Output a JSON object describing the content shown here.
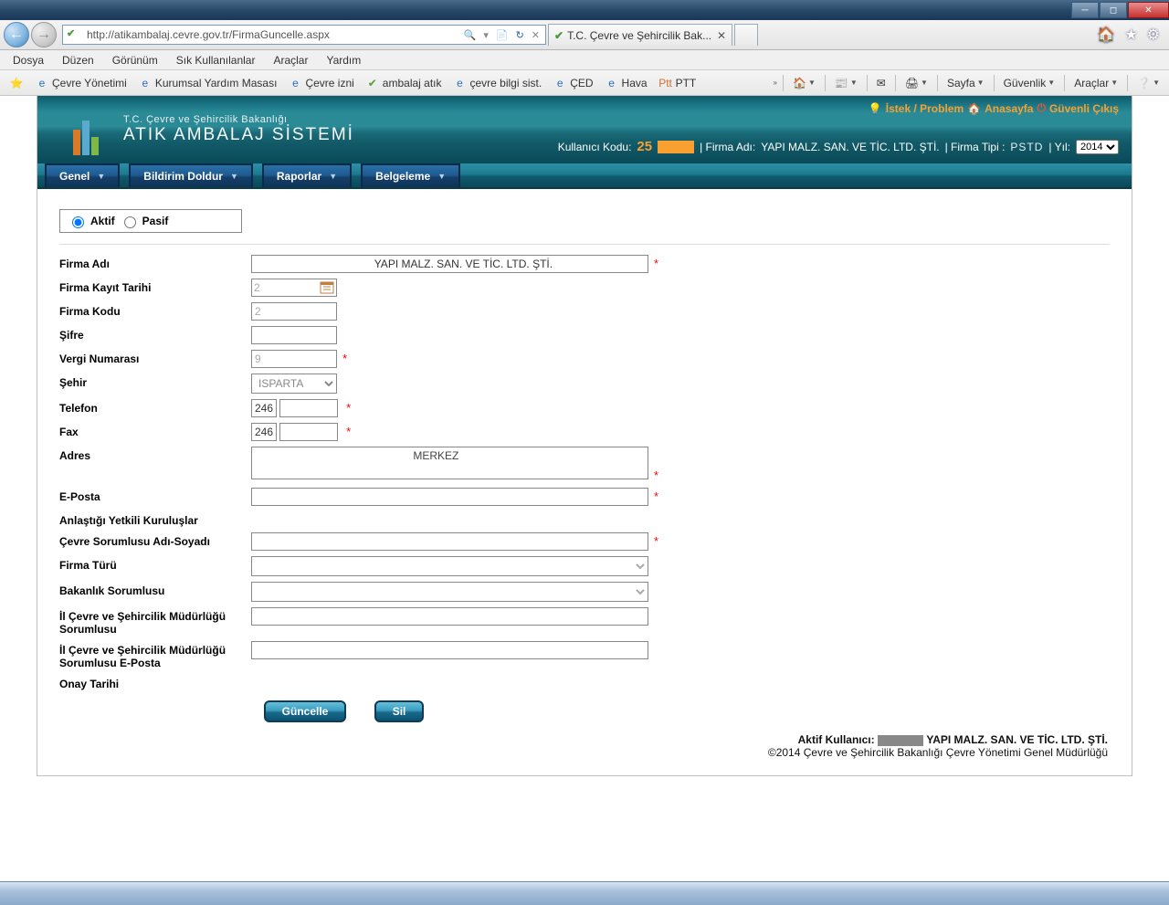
{
  "window": {
    "url": "http://atikambalaj.cevre.gov.tr/FirmaGuncelle.aspx",
    "tab_title": "T.C. Çevre ve Şehircilik Bak...",
    "search_symbols": "🔍",
    "refresh": "⟳",
    "stop": "✕"
  },
  "ie_menu": {
    "file": "Dosya",
    "edit": "Düzen",
    "view": "Görünüm",
    "favorites": "Sık Kullanılanlar",
    "tools": "Araçlar",
    "help": "Yardım"
  },
  "bookmarks": {
    "b1": "Çevre Yönetimi",
    "b2": "Kurumsal Yardım Masası",
    "b3": "Çevre izni",
    "b4": "ambalaj atık",
    "b5": "çevre bilgi sist.",
    "b6": "ÇED",
    "b7": "Hava",
    "b8": "PTT"
  },
  "ie_toolbar": {
    "page": "Sayfa",
    "safety": "Güvenlik",
    "tools": "Araçlar"
  },
  "header": {
    "ministry": "T.C. Çevre ve Şehircilik Bakanlığı",
    "title": "ATIK AMBALAJ SİSTEMİ",
    "link_problem": "İstek / Problem",
    "link_home": "Anasayfa",
    "link_logout": "Güvenli Çıkış",
    "user_code_label": "Kullanıcı Kodu:",
    "user_code_value": "25",
    "firm_label": "| Firma Adı:",
    "firm_value": "YAPI MALZ. SAN. VE TİC. LTD. ŞTİ.",
    "type_label": "| Firma Tipi :",
    "type_value": "PSTD",
    "year_label": "| Yıl:",
    "year_value": "2014"
  },
  "nav": {
    "m1": "Genel",
    "m2": "Bildirim Doldur",
    "m3": "Raporlar",
    "m4": "Belgeleme"
  },
  "form": {
    "radio_active": "Aktif",
    "radio_passive": "Pasif",
    "lbl_firma_adi": "Firma Adı",
    "val_firma_adi": "         YAPI MALZ. SAN. VE TİC. LTD. ŞTİ.",
    "lbl_kayit_tarihi": "Firma Kayıt Tarihi",
    "val_kayit_tarihi": "2",
    "lbl_firma_kodu": "Firma Kodu",
    "val_firma_kodu": "2",
    "lbl_sifre": "Şifre",
    "val_sifre": "",
    "lbl_vergi": "Vergi Numarası",
    "val_vergi": "9",
    "lbl_sehir": "Şehir",
    "val_sehir": "ISPARTA",
    "lbl_telefon": "Telefon",
    "val_tel1": "246",
    "val_tel2": "",
    "lbl_fax": "Fax",
    "val_fax1": "246",
    "val_fax2": "",
    "lbl_adres": "Adres",
    "val_adres": "                                                    MERKEZ",
    "lbl_eposta": "E-Posta",
    "val_eposta": "",
    "lbl_yetk_kurulus": "Anlaştığı Yetkili Kuruluşlar",
    "val_yetk_kurulus": "",
    "lbl_cevre_sor": "Çevre Sorumlusu Adı-Soyadı",
    "val_cevre_sor": "",
    "lbl_firma_turu": "Firma Türü",
    "val_firma_turu": "",
    "lbl_bakanlik": "Bakanlık Sorumlusu",
    "val_bakanlik": "",
    "lbl_il_sor": "İl Çevre ve Şehircilik Müdürlüğü Sorumlusu",
    "val_il_sor": "",
    "lbl_il_sor_eposta": "İl Çevre ve Şehircilik Müdürlüğü Sorumlusu E-Posta",
    "val_il_sor_eposta": "",
    "lbl_onay_tarihi": "Onay Tarihi",
    "btn_update": "Güncelle",
    "btn_delete": "Sil"
  },
  "footer": {
    "active_user_label": "Aktif Kullanıcı:",
    "active_user_value": "YAPI MALZ. SAN. VE TİC. LTD. ŞTİ.",
    "copyright": "©2014 Çevre ve Şehircilik Bakanlığı Çevre Yönetimi Genel Müdürlüğü"
  }
}
